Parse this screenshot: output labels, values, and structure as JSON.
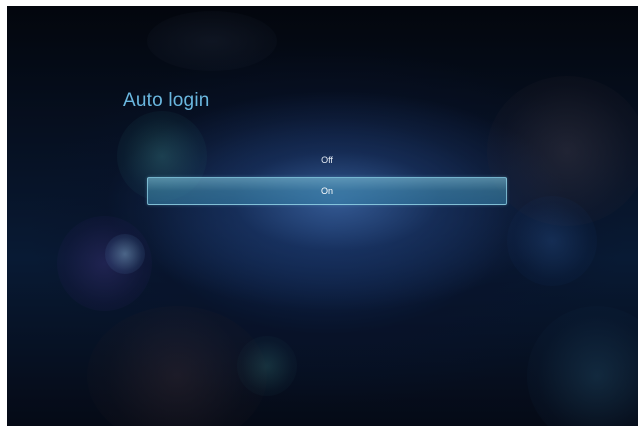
{
  "screen": {
    "title": "Auto login"
  },
  "options": [
    {
      "label": "Off",
      "selected": false
    },
    {
      "label": "On",
      "selected": true
    }
  ],
  "colors": {
    "title": "#6ab7df",
    "highlight": "#5a9fc0",
    "background": "#071327"
  }
}
